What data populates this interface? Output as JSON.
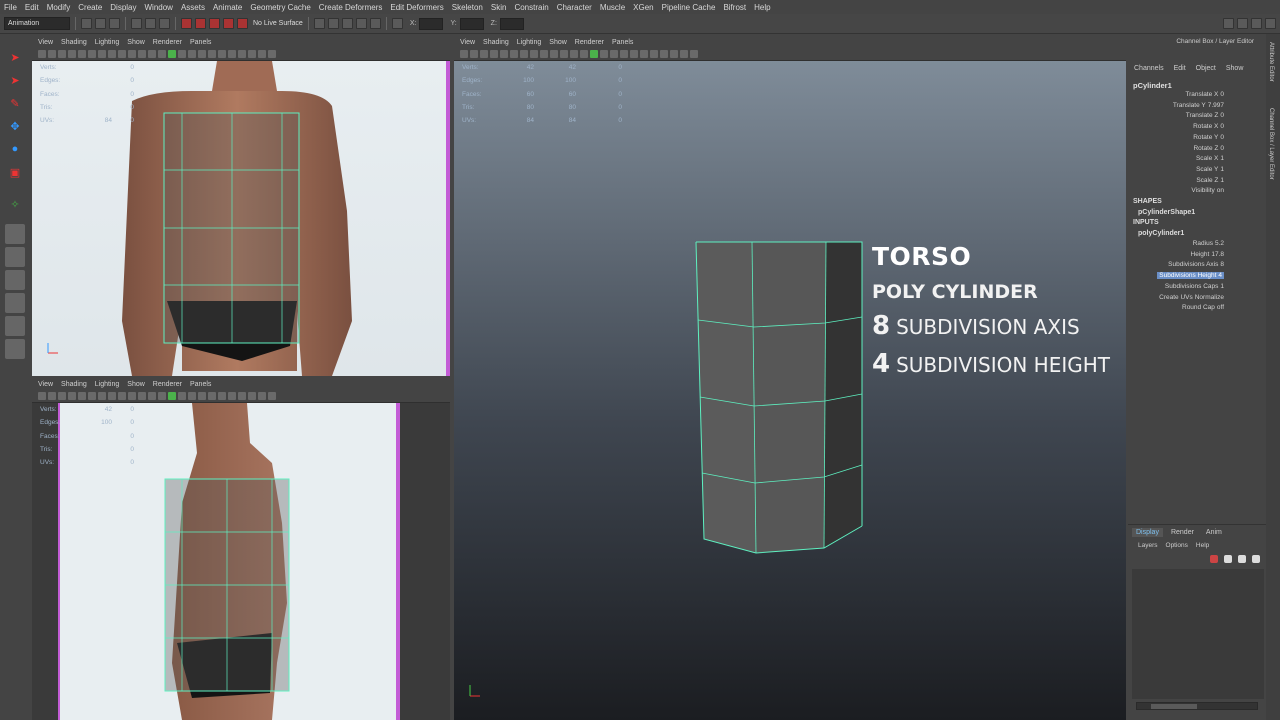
{
  "menubar": [
    "File",
    "Edit",
    "Modify",
    "Create",
    "Display",
    "Window",
    "Assets",
    "Animate",
    "Geometry Cache",
    "Create Deformers",
    "Edit Deformers",
    "Skeleton",
    "Skin",
    "Constrain",
    "Character",
    "Muscle",
    "XGen",
    "Pipeline Cache",
    "Bifrost",
    "Help"
  ],
  "statusline": {
    "mode": "Animation",
    "live_surface": "No Live Surface",
    "x_label": "X:",
    "y_label": "Y:",
    "z_label": "Z:"
  },
  "panel_menu": [
    "View",
    "Shading",
    "Lighting",
    "Show",
    "Renderer",
    "Panels"
  ],
  "panel_menu_bl": [
    "View",
    "Shading",
    "Lighting",
    "Show",
    "Renderer",
    "Panels"
  ],
  "hud_left": {
    "labels": [
      "Verts:",
      "Edges:",
      "Faces:",
      "Tris:",
      "UVs:"
    ],
    "c1": [
      "",
      "",
      "",
      "",
      "84"
    ],
    "c2": [
      "0",
      "0",
      "0",
      "0",
      "0"
    ]
  },
  "hud_bl": {
    "labels": [
      "Verts:",
      "Edges:",
      "Faces:",
      "Tris:",
      "UVs:"
    ],
    "c1": [
      "42",
      "100",
      "",
      "",
      ""
    ],
    "c2": [
      "0",
      "0",
      "0",
      "0",
      "0"
    ]
  },
  "hud_persp": {
    "labels": [
      "Verts:",
      "Edges:",
      "Faces:",
      "Tris:",
      "UVs:"
    ],
    "c1": [
      "42",
      "100",
      "60",
      "80",
      "84"
    ],
    "c2": [
      "42",
      "100",
      "60",
      "80",
      "84"
    ],
    "c3": [
      "0",
      "0",
      "0",
      "0",
      "0"
    ]
  },
  "channelbox": {
    "title": "Channel Box / Layer Editor",
    "menu": [
      "Channels",
      "Edit",
      "Object",
      "Show"
    ],
    "node": "pCylinder1",
    "attributes": [
      {
        "name": "Translate X",
        "value": "0"
      },
      {
        "name": "Translate Y",
        "value": "7.997"
      },
      {
        "name": "Translate Z",
        "value": "0"
      },
      {
        "name": "Rotate X",
        "value": "0"
      },
      {
        "name": "Rotate Y",
        "value": "0"
      },
      {
        "name": "Rotate Z",
        "value": "0"
      },
      {
        "name": "Scale X",
        "value": "1"
      },
      {
        "name": "Scale Y",
        "value": "1"
      },
      {
        "name": "Scale Z",
        "value": "1"
      },
      {
        "name": "Visibility",
        "value": "on"
      }
    ],
    "shapes_label": "SHAPES",
    "shape_node": "pCylinderShape1",
    "inputs_label": "INPUTS",
    "input_node": "polyCylinder1",
    "input_attributes": [
      {
        "name": "Radius",
        "value": "5.2"
      },
      {
        "name": "Height",
        "value": "17.8"
      },
      {
        "name": "Subdivisions Axis",
        "value": "8"
      },
      {
        "name": "Subdivisions Height",
        "value": "4"
      },
      {
        "name": "Subdivisions Caps",
        "value": "1"
      },
      {
        "name": "Create UVs",
        "value": "Normalize"
      },
      {
        "name": "Round Cap",
        "value": "off"
      }
    ]
  },
  "side_tabs": [
    "Attribute Editor",
    "Channel Box / Layer Editor"
  ],
  "layers": {
    "tabs": [
      "Display",
      "Render",
      "Anim"
    ],
    "menu": [
      "Layers",
      "Options",
      "Help"
    ]
  },
  "overlay": {
    "title": "TORSO",
    "subtitle": "POLY CYLINDER",
    "axis_num": "8",
    "axis_label": "SUBDIVISION AXIS",
    "height_num": "4",
    "height_label": "SUBDIVISION HEIGHT"
  },
  "colors": {
    "wireframe": "#5ef0c0",
    "selection": "#6a8fc7",
    "accent": "#4bb24b"
  }
}
